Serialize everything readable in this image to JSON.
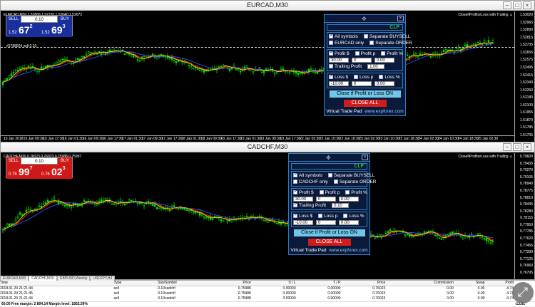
{
  "windows": [
    {
      "title": "EURCAD,M30",
      "symbol_info": "EURCAD,M30  1.52689 1.52720 1.52640 1.52672",
      "ea_label": "CloseIfProfitorLoss with Trailing ☺",
      "line_label": "#2788604 sell 0.10",
      "oneclick": {
        "sell": "SELL",
        "buy": "BUY",
        "lot": "0.10",
        "sell_small": "1.52",
        "sell_big": "67",
        "sell_sup": "2",
        "buy_small": "1.52",
        "buy_big": "69",
        "buy_sup": "3",
        "color": "#1a2f9e"
      },
      "price_labels": [
        "1.53020",
        "1.52965",
        "1.52890",
        "1.52815",
        "1.52735",
        "1.52655",
        "1.52575",
        "1.52495",
        "1.52415",
        "1.52340",
        "1.52260",
        "1.52180",
        "1.52100",
        "1.51955",
        "1.51870",
        "1.51785",
        "1.51705"
      ],
      "time_labels": [
        "15 Jan 2018",
        "15 Jan 09:30",
        "15 Jan 17:30",
        "16 Jan 01:30",
        "16 Jan 09:30",
        "16 Jan 17:30",
        "17 Jan 01:30",
        "17 Jan 09:30",
        "17 Jan 17:30",
        "18 Jan 01:30",
        "18 Jan 09:30",
        "18 Jan 17:30",
        "19 Jan 01:30",
        "19 Jan 09:30",
        "19 Jan 17:30",
        "22 Jan 02:30",
        "22 Jan 10:30",
        "22 Jan 18:30",
        "23 Jan 02:30",
        "23 Jan 10:30",
        "23 Jan 18:30",
        "24 Jan 02:30",
        "24 Jan 10:30",
        "24 Jan 18:30",
        "25 Jan 02:30"
      ],
      "panel": {
        "clp": "CLP",
        "all_symbols": "All symbols",
        "sep_buysell": "Separate BUYSELL",
        "only": "EURCAD only",
        "sep_order": "Separate ORDER",
        "profit_dollar": "Profit $",
        "profit_p": "Profit p",
        "profit_pct": "Profit %",
        "profit_dollar_val": "30.00",
        "profit_p_val": "0",
        "profit_pct_val": "0.00",
        "trailing": "Trailing Profit",
        "trailing_val": "1.00",
        "loss_dollar": "Loss $",
        "loss_p": "Loss p",
        "loss_pct": "Loss %",
        "loss_dollar_val": "-10.00",
        "loss_p_val": "0",
        "loss_pct_val": "0.00",
        "close_btn": "Close if Profit or Loss ON",
        "close_all": "CLOSE ALL",
        "footer": "Virtual Trade Pad",
        "footer_link": "www.expforex.com"
      }
    },
    {
      "title": "CADCHF,M30",
      "symbol_info": "CADCHF,M30  0.76023 0.76023 0.75988 0.75997",
      "ea_label": "CloseIfProfitorLoss with Trailing ☺",
      "oneclick": {
        "sell": "SELL",
        "buy": "BUY",
        "lot": "0.10",
        "sell_small": "0.75",
        "sell_big": "99",
        "sell_sup": "7",
        "buy_small": "0.76",
        "buy_big": "02",
        "buy_sup": "3",
        "color": "#d01818"
      },
      "price_labels": [
        "0.79600",
        "0.79435",
        "0.79270",
        "0.79105",
        "0.78940",
        "0.78775",
        "0.78610",
        "0.78445",
        "0.78280",
        "0.78115",
        "0.77950",
        "0.77785",
        "0.77620",
        "0.77455",
        "0.77290",
        "0.77125",
        "0.76960",
        "0.76795"
      ],
      "panel": {
        "clp": "CLP",
        "all_symbols": "All symbols",
        "sep_buysell": "Separate BUYSELL",
        "only": "CADCHF only",
        "sep_order": "Separate ORDER",
        "profit_dollar": "Profit $",
        "profit_p": "Profit p",
        "profit_pct": "Profit %",
        "profit_dollar_val": "30.00",
        "profit_p_val": "0",
        "profit_pct_val": "0.00",
        "trailing": "Trailing Profit",
        "trailing_val": "0.10",
        "loss_dollar": "Loss $",
        "loss_p": "Loss p",
        "loss_pct": "Loss %",
        "loss_dollar_val": "-10.00",
        "loss_p_val": "0",
        "loss_pct_val": "0.00",
        "close_btn": "Close if Profit or Loss ON",
        "close_all": "CLOSE ALL",
        "footer": "Virtual Trade Pad",
        "footer_link": "www.expforex.com"
      }
    }
  ],
  "tabs": [
    "EURCAD,M30",
    "CADCHF,M30",
    "GBPUSD,Weekly",
    "USDJPY,H4"
  ],
  "terminal": {
    "columns": [
      "Time",
      "Type",
      "Size",
      "Symbol",
      "Price",
      "S / L",
      "T / P",
      "Price",
      "Commission",
      "Swap",
      "Profit"
    ],
    "rows": [
      [
        "2018.01.29 21:21:44",
        "sell",
        "0.10",
        "cadchf",
        "0.75988",
        "0.00000",
        "0.00000",
        "0.76023",
        "0.00",
        "0.00",
        "-4.74"
      ],
      [
        "2018.01.29 21:21:45",
        "sell",
        "0.10",
        "cadchf",
        "0.75988",
        "0.00000",
        "0.00000",
        "0.76023",
        "0.00",
        "0.00",
        "-4.74"
      ],
      [
        "2018.01.29 21:21:44",
        "sell",
        "0.10",
        "cadchf",
        "0.75988",
        "0.00000",
        "0.00000",
        "0.76023",
        "0.00",
        "0.00",
        "-4.74"
      ]
    ],
    "status": "60.00  Free margin: 2 804.14  Margin level: 1852.59%",
    "total": "-13.81"
  }
}
